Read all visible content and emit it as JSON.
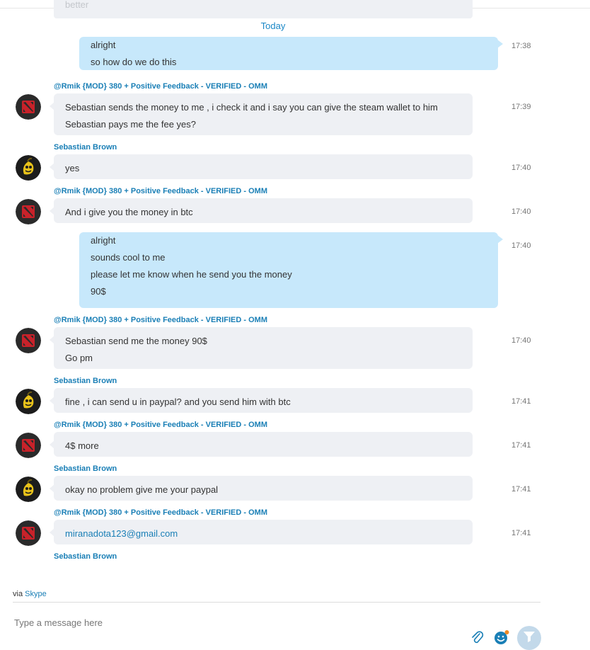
{
  "previous_message": {
    "text": "better"
  },
  "date_separator": "Today",
  "messages": [
    {
      "sender": "",
      "direction": "out",
      "lines": [
        "alright",
        "so how do we do this"
      ],
      "time": "17:38"
    },
    {
      "sender": "@Rmik {MOD} 380 + Positive Feedback - VERIFIED - OMM",
      "direction": "in",
      "avatar": "dota-logo",
      "lines": [
        "Sebastian sends the money to me , i check it and i say you can give the steam wallet to him",
        "Sebastian pays me the fee yes?"
      ],
      "time": "17:39"
    },
    {
      "sender": "Sebastian Brown",
      "direction": "in",
      "avatar": "banana",
      "lines": [
        "yes"
      ],
      "time": "17:40"
    },
    {
      "sender": "@Rmik {MOD} 380 + Positive Feedback - VERIFIED - OMM",
      "direction": "in",
      "avatar": "dota-logo",
      "lines": [
        "And i give you the money in btc"
      ],
      "time": "17:40"
    },
    {
      "sender": "",
      "direction": "out",
      "lines": [
        "alright",
        "sounds cool to me",
        "please let me know when he send you the money",
        "90$"
      ],
      "time": "17:40"
    },
    {
      "sender": "@Rmik {MOD} 380 + Positive Feedback - VERIFIED - OMM",
      "direction": "in",
      "avatar": "dota-logo",
      "lines": [
        "Sebastian send me the money 90$",
        "Go pm"
      ],
      "time": "17:40"
    },
    {
      "sender": "Sebastian Brown",
      "direction": "in",
      "avatar": "banana",
      "lines": [
        "fine , i can send u in paypal? and you send him with btc"
      ],
      "time": "17:41"
    },
    {
      "sender": "@Rmik {MOD} 380 + Positive Feedback - VERIFIED - OMM",
      "direction": "in",
      "avatar": "dota-logo",
      "lines": [
        "4$ more"
      ],
      "time": "17:41"
    },
    {
      "sender": "Sebastian Brown",
      "direction": "in",
      "avatar": "banana",
      "lines": [
        "okay no problem give me your paypal"
      ],
      "time": "17:41"
    },
    {
      "sender": "@Rmik {MOD} 380 + Positive Feedback - VERIFIED - OMM",
      "direction": "in",
      "avatar": "dota-logo",
      "lines": [
        "miranadota123@gmail.com"
      ],
      "link": true,
      "time": "17:41"
    },
    {
      "sender": "Sebastian Brown",
      "direction": "in",
      "avatar": "banana",
      "lines": [],
      "time": ""
    }
  ],
  "footer": {
    "via_label": "via",
    "via_link": "Skype",
    "input_placeholder": "Type a message here",
    "icons": [
      "paperclip-icon",
      "emoji-icon",
      "send-icon"
    ]
  },
  "colors": {
    "accent": "#1a7fb6",
    "outgoing_bubble": "#c7e8fb",
    "incoming_bubble": "#eef0f4",
    "timestamp": "#767676"
  }
}
